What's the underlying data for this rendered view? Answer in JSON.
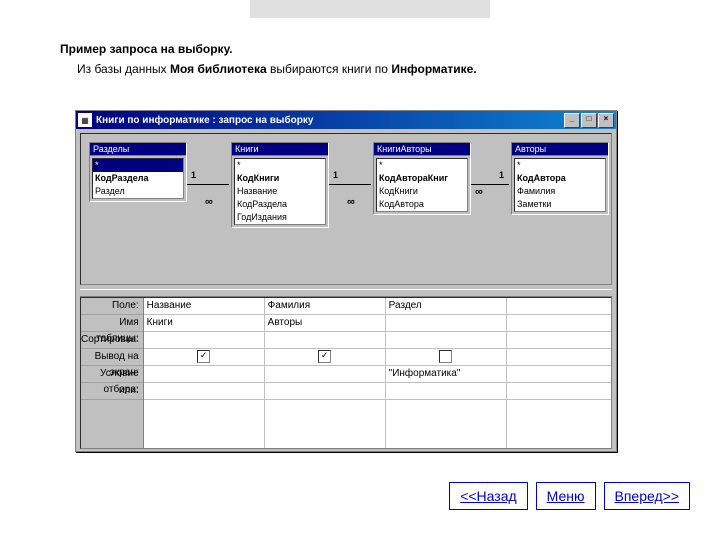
{
  "heading": "Пример запроса на выборку.",
  "subtext_prefix": "Из базы данных ",
  "subtext_bold1": "Моя библиотека",
  "subtext_mid": " выбираются книги по ",
  "subtext_bold2": "Информатике.",
  "window": {
    "title": "Книги по информатике : запрос на выборку",
    "min": "_",
    "max": "□",
    "close": "×"
  },
  "tables": [
    {
      "name": "Разделы",
      "fields": [
        "*",
        "КодРаздела",
        "Раздел"
      ],
      "bold": 1,
      "sel": 0
    },
    {
      "name": "Книги",
      "fields": [
        "*",
        "КодКниги",
        "Название",
        "КодРаздела",
        "ГодИздания"
      ],
      "bold": 1
    },
    {
      "name": "КнигиАвторы",
      "fields": [
        "*",
        "КодАвтораКниг",
        "КодКниги",
        "КодАвтора"
      ],
      "bold": 1
    },
    {
      "name": "Авторы",
      "fields": [
        "*",
        "КодАвтора",
        "Фамилия",
        "Заметки"
      ],
      "bold": 1
    }
  ],
  "rel": {
    "one": "1",
    "many": "∞"
  },
  "gridLabels": [
    "Поле:",
    "Имя таблицы:",
    "Сортировка:",
    "Вывод на экран:",
    "Условие отбора:",
    "или:"
  ],
  "gridCols": [
    {
      "field": "Название",
      "table": "Книги",
      "show": true,
      "crit": ""
    },
    {
      "field": "Фамилия",
      "table": "Авторы",
      "show": true,
      "crit": ""
    },
    {
      "field": "Раздел",
      "table": "",
      "show": false,
      "crit": "\"Информатика\""
    },
    {
      "field": "",
      "table": "",
      "show": null,
      "crit": ""
    }
  ],
  "nav": {
    "back": "<<Назад",
    "menu": "Меню",
    "fwd": "Вперед>>"
  }
}
